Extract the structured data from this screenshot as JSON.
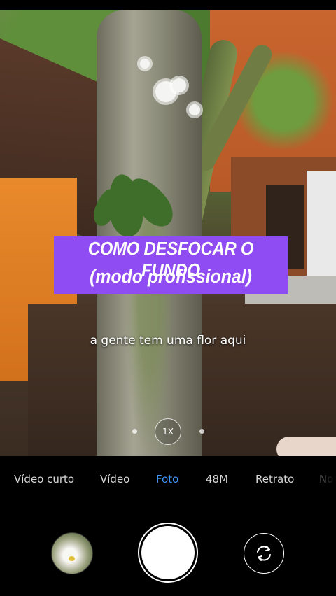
{
  "overlay": {
    "title_line1": "COMO DESFOCAR O FUNDO",
    "title_line2": "(modo profissional)",
    "subtitle": "a gente tem uma flor aqui",
    "title_bg_color": "#8e4cf2"
  },
  "viewfinder": {
    "zoom_label": "1X"
  },
  "mode_bar": {
    "modes": [
      "Vídeo curto",
      "Vídeo",
      "Foto",
      "48M",
      "Retrato",
      "No"
    ],
    "active_mode": "Foto",
    "active_color": "#3b98ff"
  },
  "controls": {
    "gallery_icon": "gallery-thumbnail",
    "shutter_icon": "shutter-button",
    "switch_icon": "camera-switch-icon"
  }
}
